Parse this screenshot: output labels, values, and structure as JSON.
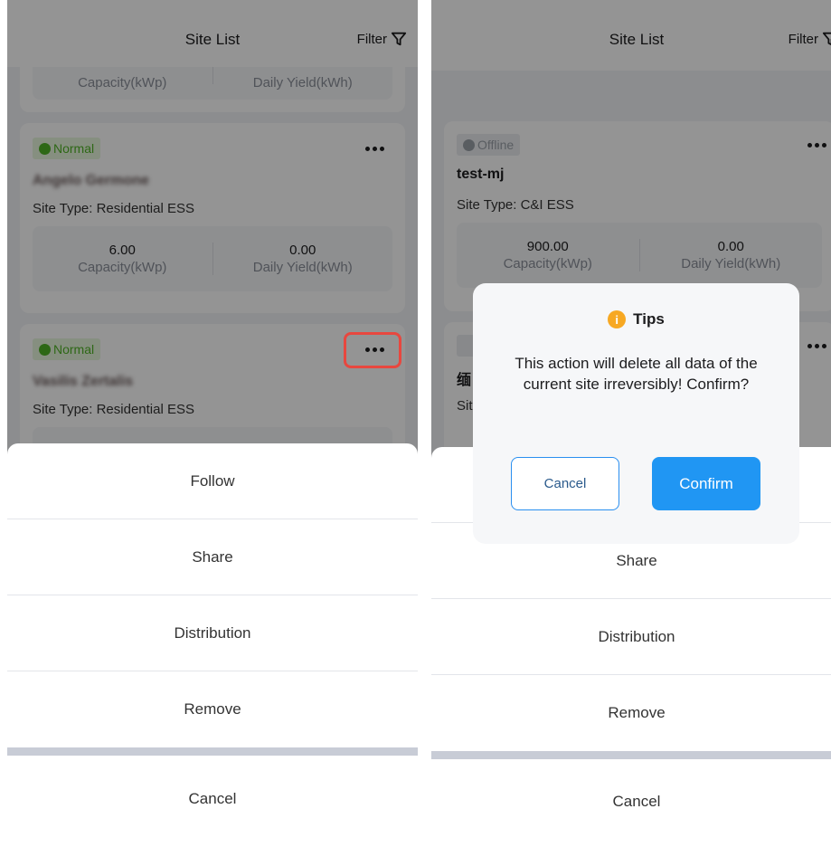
{
  "left": {
    "header": {
      "title": "Site List",
      "filter_label": "Filter"
    },
    "top_card": {
      "capacity_label": "Capacity(kWp)",
      "yield_label": "Daily Yield(kWh)"
    },
    "cards": [
      {
        "status": "Normal",
        "name": "Angelo Germone",
        "site_type": "Site Type: Residential ESS",
        "capacity_value": "6.00",
        "capacity_label": "Capacity(kWp)",
        "yield_value": "0.00",
        "yield_label": "Daily Yield(kWh)"
      },
      {
        "status": "Normal",
        "name": "Vasilis Zertalis",
        "site_type": "Site Type: Residential ESS"
      }
    ],
    "action_sheet": {
      "items": [
        "Follow",
        "Share",
        "Distribution",
        "Remove"
      ],
      "cancel": "Cancel"
    }
  },
  "right": {
    "header": {
      "title": "Site List",
      "filter_label": "Filter"
    },
    "cards": [
      {
        "status": "Offline",
        "name": "test-mj",
        "site_type": "Site Type: C&I ESS",
        "capacity_value": "900.00",
        "capacity_label": "Capacity(kWp)",
        "yield_value": "0.00",
        "yield_label": "Daily Yield(kWh)"
      },
      {
        "name_partial": "缅",
        "site_type_partial": "Sit"
      }
    ],
    "action_sheet": {
      "items": [
        "Share",
        "Distribution",
        "Remove"
      ],
      "cancel": "Cancel"
    },
    "dialog": {
      "title": "Tips",
      "message": "This action will delete all data of the current site irreversibly! Confirm?",
      "cancel_label": "Cancel",
      "confirm_label": "Confirm"
    }
  },
  "icons": {
    "filter": "filter-funnel-icon",
    "status_normal": "check-circle-icon",
    "status_offline": "x-circle-icon",
    "more": "more-dots-icon",
    "tips": "info-icon"
  },
  "colors": {
    "accent": "#2096f3",
    "normal": "#4fb325",
    "offline": "#9aa0a8",
    "highlight": "#e8473f",
    "tips_icon": "#f7a823"
  }
}
